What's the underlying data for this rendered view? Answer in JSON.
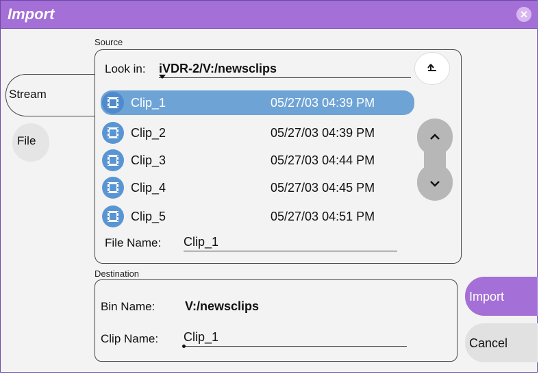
{
  "window": {
    "title": "Import",
    "close_icon": "close-icon"
  },
  "tabs": [
    {
      "label": "Stream",
      "selected": true
    },
    {
      "label": "File",
      "selected": false
    }
  ],
  "source": {
    "section_label": "Source",
    "look_in_label": "Look in:",
    "look_in_value": "iVDR-2/V:/newsclips",
    "up_folder_icon": "up-folder-icon",
    "clips": [
      {
        "name": "Clip_1",
        "date": "05/27/03 04:39 PM",
        "selected": true
      },
      {
        "name": "Clip_2",
        "date": "05/27/03 04:39 PM",
        "selected": false
      },
      {
        "name": "Clip_3",
        "date": "05/27/03 04:44 PM",
        "selected": false
      },
      {
        "name": "Clip_4",
        "date": "05/27/03 04:45 PM",
        "selected": false
      },
      {
        "name": "Clip_5",
        "date": "05/27/03 04:51 PM",
        "selected": false
      }
    ],
    "file_name_label": "File Name:",
    "file_name_value": "Clip_1"
  },
  "destination": {
    "section_label": "Destination",
    "bin_name_label": "Bin Name:",
    "bin_name_value": "V:/newsclips",
    "clip_name_label": "Clip Name:",
    "clip_name_value": "Clip_1"
  },
  "actions": {
    "import_label": "Import",
    "cancel_label": "Cancel"
  },
  "colors": {
    "title_bar": "#a46fd6",
    "selection": "#6ea3d6",
    "clip_icon": "#5a95d3",
    "scroll_buttons": "#b7b7b7"
  }
}
